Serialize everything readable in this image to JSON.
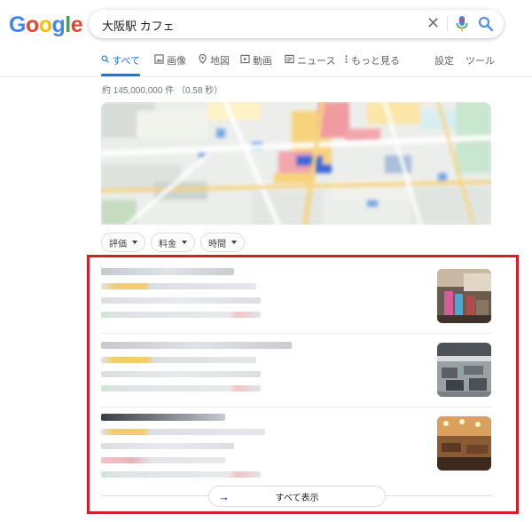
{
  "logo": {
    "letters": [
      "G",
      "o",
      "o",
      "g",
      "l",
      "e"
    ],
    "colors": [
      "#4285f4",
      "#ea4335",
      "#fbbc05",
      "#4285f4",
      "#34a853",
      "#ea4335"
    ]
  },
  "search": {
    "query": "大阪駅 カフェ",
    "clear_glyph": "✕"
  },
  "tabs": [
    {
      "label": "すべて",
      "icon": "search-icon"
    },
    {
      "label": "画像",
      "icon": "image-icon"
    },
    {
      "label": "地図",
      "icon": "map-pin-icon"
    },
    {
      "label": "動画",
      "icon": "video-icon"
    },
    {
      "label": "ニュース",
      "icon": "news-icon"
    },
    {
      "label": "もっと見る",
      "icon": "more-vert-icon"
    }
  ],
  "tools": {
    "settings": "設定",
    "tools": "ツール"
  },
  "result_stats": "約 145,000,000 件 （0.58 秒）",
  "filters": [
    {
      "label": "評価"
    },
    {
      "label": "料金"
    },
    {
      "label": "時間"
    }
  ],
  "show_all": "すべて表示",
  "colors": {
    "accent": "#1a73e8",
    "highlight_box": "#d71d2a",
    "star": "#fbbc05"
  }
}
